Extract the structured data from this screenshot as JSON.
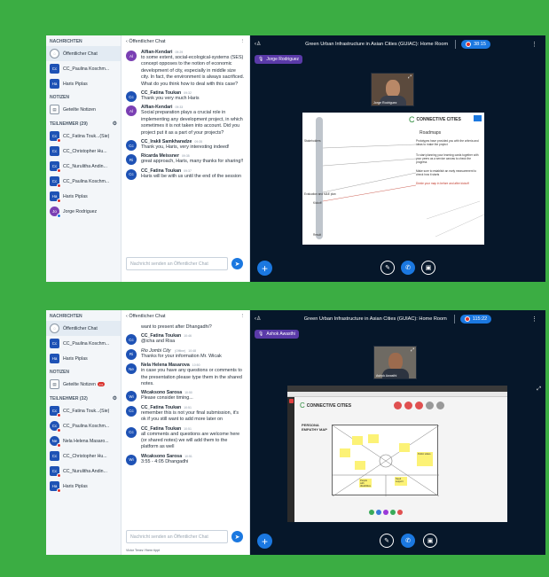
{
  "shots": [
    {
      "sidebar": {
        "messages_header": "NACHRICHTEN",
        "public_chat": "Öffentlicher Chat",
        "private_chats": [
          {
            "initials": "Cc",
            "name": "CC_Paulina Koschm...",
            "color": "#1e52b5"
          },
          {
            "initials": "Ha",
            "name": "Haris Piplas",
            "color": "#1e52b5"
          }
        ],
        "notes_header": "NOTIZEN",
        "shared_notes": "Geteilte Notizen",
        "participants_header": "TEILNEHMER (29)",
        "participants": [
          {
            "initials": "Cc",
            "name": "CC_Fatina Touk...(Sie)",
            "color": "#1e52b5",
            "dot": true
          },
          {
            "initials": "Cc",
            "name": "CC_Christopher Hu...",
            "color": "#1e52b5",
            "dot": false
          },
          {
            "initials": "Cc",
            "name": "CC_Nurulitha Andin...",
            "color": "#1e52b5",
            "dot": true
          },
          {
            "initials": "Cc",
            "name": "CC_Paulina Koschm...",
            "color": "#1e52b5",
            "dot": true
          },
          {
            "initials": "Ha",
            "name": "Haris Piplas",
            "color": "#1e52b5",
            "dot": true
          },
          {
            "initials": "Jo",
            "name": "Jorge Rodriguez",
            "color": "#7a3fb3",
            "dot": true
          }
        ]
      },
      "chat": {
        "header": "Öffentlicher Chat",
        "messages": [
          {
            "initials": "Al",
            "color": "#7a3fb3",
            "name": "Alfian-Kendari",
            "time": "09:29",
            "text": "to some extent, social-ecological-systems (SES) concept opposes to the notion of economic development of city, especially in middle size city. In fact, the environment is always sacrificed. What do you think how to deal with this case?"
          },
          {
            "initials": "Cc",
            "color": "#1e52b5",
            "name": "CC_Fatina Toukan",
            "time": "09:32",
            "text": "Thank you very much Haris"
          },
          {
            "initials": "Al",
            "color": "#7a3fb3",
            "name": "Alfian-Kendari",
            "time": "09:33",
            "text": "Social preparation plays a crucial role in implementing any development project, in which sometimes it is not taken into account. Did you project put it as a part of your projects?"
          },
          {
            "initials": "Cc",
            "color": "#1e52b5",
            "name": "CC_Irakli Samkharadze",
            "time": "09:35",
            "text": "Thank you, Haris, very interesting indeed!"
          },
          {
            "initials": "Ri",
            "color": "#1e52b5",
            "name": "Ricarda Meissner",
            "time": "09:35",
            "text": "great approach, Haris, many thanks for sharing!!"
          },
          {
            "initials": "Cc",
            "color": "#1e52b5",
            "name": "CC_Fatina Toukan",
            "time": "09:37",
            "text": "Haris will be with us until the end of the session"
          }
        ],
        "input_placeholder": "Nachricht senden an Öffentlicher Chat",
        "typing": ""
      },
      "main": {
        "title": "Green Urban Infrastructure in Asian Cities (GUIAC): Home Room",
        "timer": "38:15",
        "talking": "Jorge Rodriguez",
        "cam_name": "Jorge Rodriguez",
        "slide_logo": "CONNECTIVE CITIES",
        "slide_title": "Roadmaps",
        "slide_notes": [
          "Prototypes have provided you with the criteria and ideas to make the project",
          "To start planning your learning cards together with your peers as a service canvas to check the progress",
          "Make sure to establish an early measurement to check how it starts",
          "Divide your map in before and after kickoff"
        ],
        "slide_labels": [
          "Stakeholders",
          "Kickoff",
          "Evaluation and M&E plan",
          "Result"
        ]
      }
    },
    {
      "sidebar": {
        "messages_header": "NACHRICHTEN",
        "public_chat": "Öffentlicher Chat",
        "private_chats": [
          {
            "initials": "Cc",
            "name": "CC_Paulina Koschm...",
            "color": "#1e52b5"
          },
          {
            "initials": "Ha",
            "name": "Haris Piplas",
            "color": "#1e52b5"
          }
        ],
        "notes_header": "NOTIZEN",
        "shared_notes": "Geteilte Notizen",
        "notes_badge": "•••",
        "participants_header": "TEILNEHMER (32)",
        "participants": [
          {
            "initials": "Cc",
            "name": "CC_Fatina Touk...(Sie)",
            "color": "#1e52b5",
            "dot": true
          },
          {
            "initials": "Cc",
            "name": "CC_Paulina Koschm...",
            "color": "#1e52b5",
            "dot": true
          },
          {
            "initials": "Ne",
            "name": "Nela Helena Masaro...",
            "color": "#1e52b5",
            "dot": true
          },
          {
            "initials": "Cc",
            "name": "CC_Christopher Hu...",
            "color": "#1e52b5",
            "dot": false
          },
          {
            "initials": "Cc",
            "name": "CC_Nurulitha Andin...",
            "color": "#1e52b5",
            "dot": true
          },
          {
            "initials": "Ha",
            "name": "Haris Piplas",
            "color": "#1e52b5",
            "dot": true
          }
        ]
      },
      "chat": {
        "header": "Öffentlicher Chat",
        "top_fragment": "want to present after Dhangadhi?",
        "messages": [
          {
            "initials": "Cc",
            "color": "#1e52b5",
            "name": "CC_Fatina Toukan",
            "time": "10:46",
            "text": "@icha and Risa"
          },
          {
            "initials": "Ri",
            "color": "#1e52b5",
            "name": "Rio Jombi City",
            "name_suffix": "(Offline)",
            "time": "10:48",
            "text": "Thanks for your information Mr. Wicak",
            "italic": true
          },
          {
            "initials": "Ne",
            "color": "#1e52b5",
            "name": "Nela Helena Masarova",
            "time": "10:50",
            "text": "in case you have any questions or comments to the presentation please type them in the shared notes."
          },
          {
            "initials": "Wi",
            "color": "#1e52b5",
            "name": "Wicaksono Sarosa",
            "time": "10:50",
            "text": "Please consider timing..."
          },
          {
            "initials": "Cc",
            "color": "#1e52b5",
            "name": "CC_Fatina Toukan",
            "time": "10:51",
            "text": "remember this is not your final submission, it's ok if you still want to add more later on"
          },
          {
            "initials": "Cc",
            "color": "#1e52b5",
            "name": "CC_Fatina Toukan",
            "time": "10:51",
            "text": "all comments and questions are welcome here (or shared notes) we will add them to the platform as well"
          },
          {
            "initials": "Wi",
            "color": "#1e52b5",
            "name": "Wicaksono Sarosa",
            "time": "10:51",
            "text": "3:55 - 4:05 Dhangadhi"
          }
        ],
        "input_placeholder": "Nachricht senden an Öffentlicher Chat",
        "typing": "Victor Tenez Ybern tippt"
      },
      "main": {
        "title": "Green Urban Infrastructure in Asian Cities (GUIAC): Home Room",
        "timer": "115:22",
        "talking": "Ashok Awasthi",
        "cam_name": "Ashok Awasthi",
        "slide_logo": "CONNECTIVE CITIES",
        "slide_title": "PERSONA EMPATHY MAP",
        "sticky_notes": [
          "People with disabilities",
          "Need support",
          "Public toilets"
        ]
      }
    }
  ],
  "colors": {
    "accent": "#1b78e0",
    "dark_bg": "#06172a",
    "frame": "#3bad43"
  }
}
